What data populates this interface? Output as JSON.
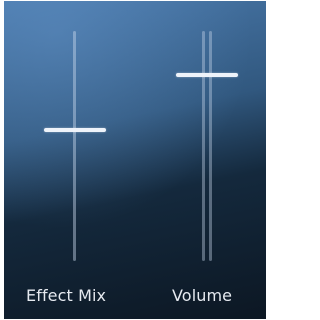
{
  "faders": {
    "effect_mix": {
      "label": "Effect Mix",
      "value": 0.57
    },
    "volume": {
      "label": "Volume",
      "value": 0.81
    }
  },
  "colors": {
    "background_top": "#4a79ab",
    "background_bottom": "#0c1723",
    "thumb": "#eef3fa",
    "label": "#e6eaf0"
  }
}
